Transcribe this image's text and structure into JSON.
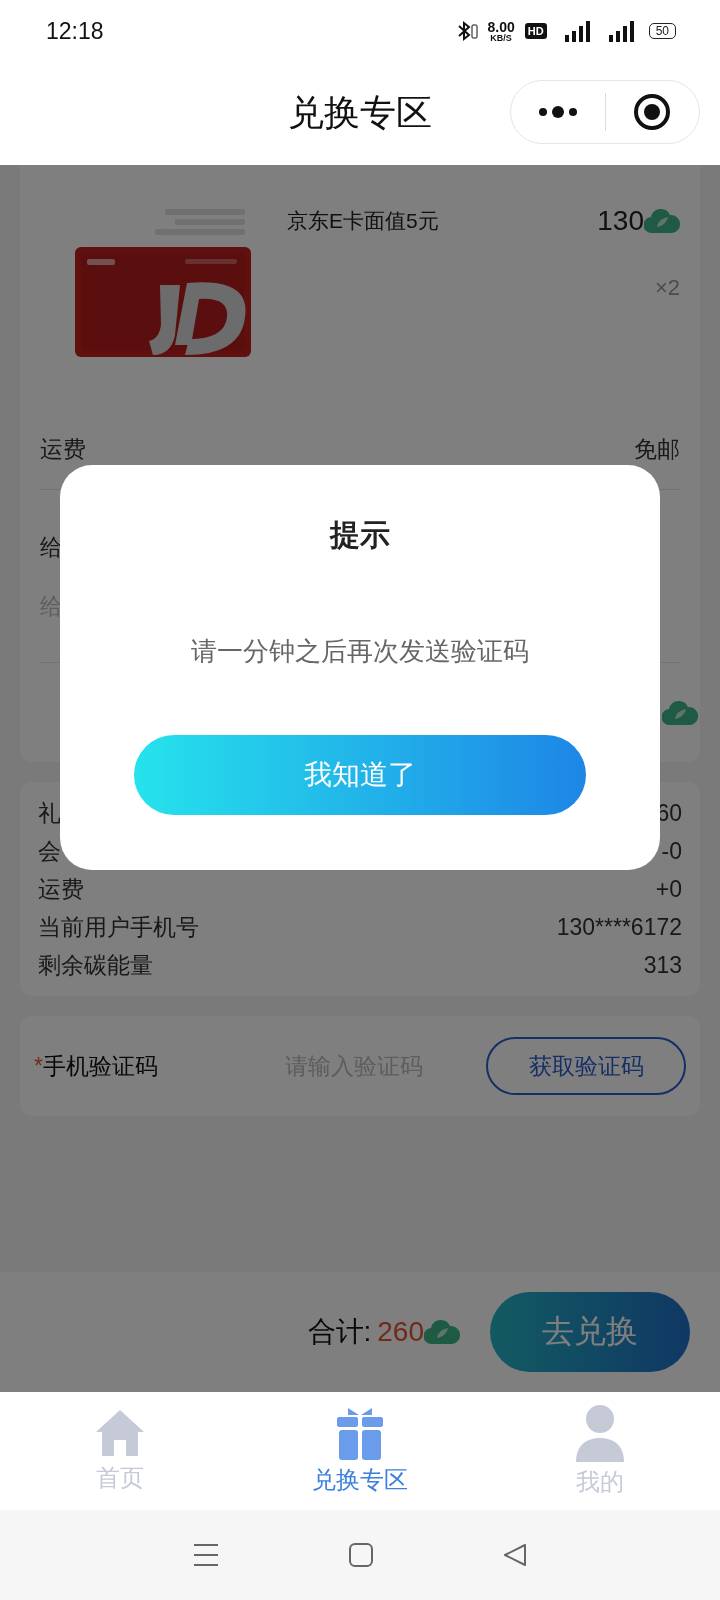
{
  "status_bar": {
    "time": "12:18",
    "speed": "8.00",
    "speed_unit": "KB/S",
    "hd": "HD",
    "battery": "50"
  },
  "nav": {
    "title": "兑换专区"
  },
  "product": {
    "kind": "picture",
    "title": "京东E卡面值5元",
    "price": "130",
    "quantity": "×2"
  },
  "shipping": {
    "label": "运费",
    "value": "免邮"
  },
  "message": {
    "label": "给",
    "placeholder": "给"
  },
  "summary": [
    {
      "label": "礼",
      "value": "60"
    },
    {
      "label": "会",
      "value": "-0"
    },
    {
      "label": "运费",
      "value": "+0"
    },
    {
      "label": "当前用户手机号",
      "value": "130****6172"
    },
    {
      "label": "剩余碳能量",
      "value": "313"
    }
  ],
  "verify": {
    "required_mark": "*",
    "label": "手机验证码",
    "placeholder": "请输入验证码",
    "button": "获取验证码"
  },
  "footer": {
    "total_label": "合计:",
    "total": "260",
    "submit": "去兑换"
  },
  "tabs": [
    {
      "label": "首页",
      "kind": "home",
      "selected": false
    },
    {
      "label": "兑换专区",
      "kind": "gift",
      "selected": true
    },
    {
      "label": "我的",
      "kind": "user",
      "selected": false
    }
  ],
  "dialog": {
    "title": "提示",
    "message": "请一分钟之后再次发送验证码",
    "button": "我知道了"
  }
}
